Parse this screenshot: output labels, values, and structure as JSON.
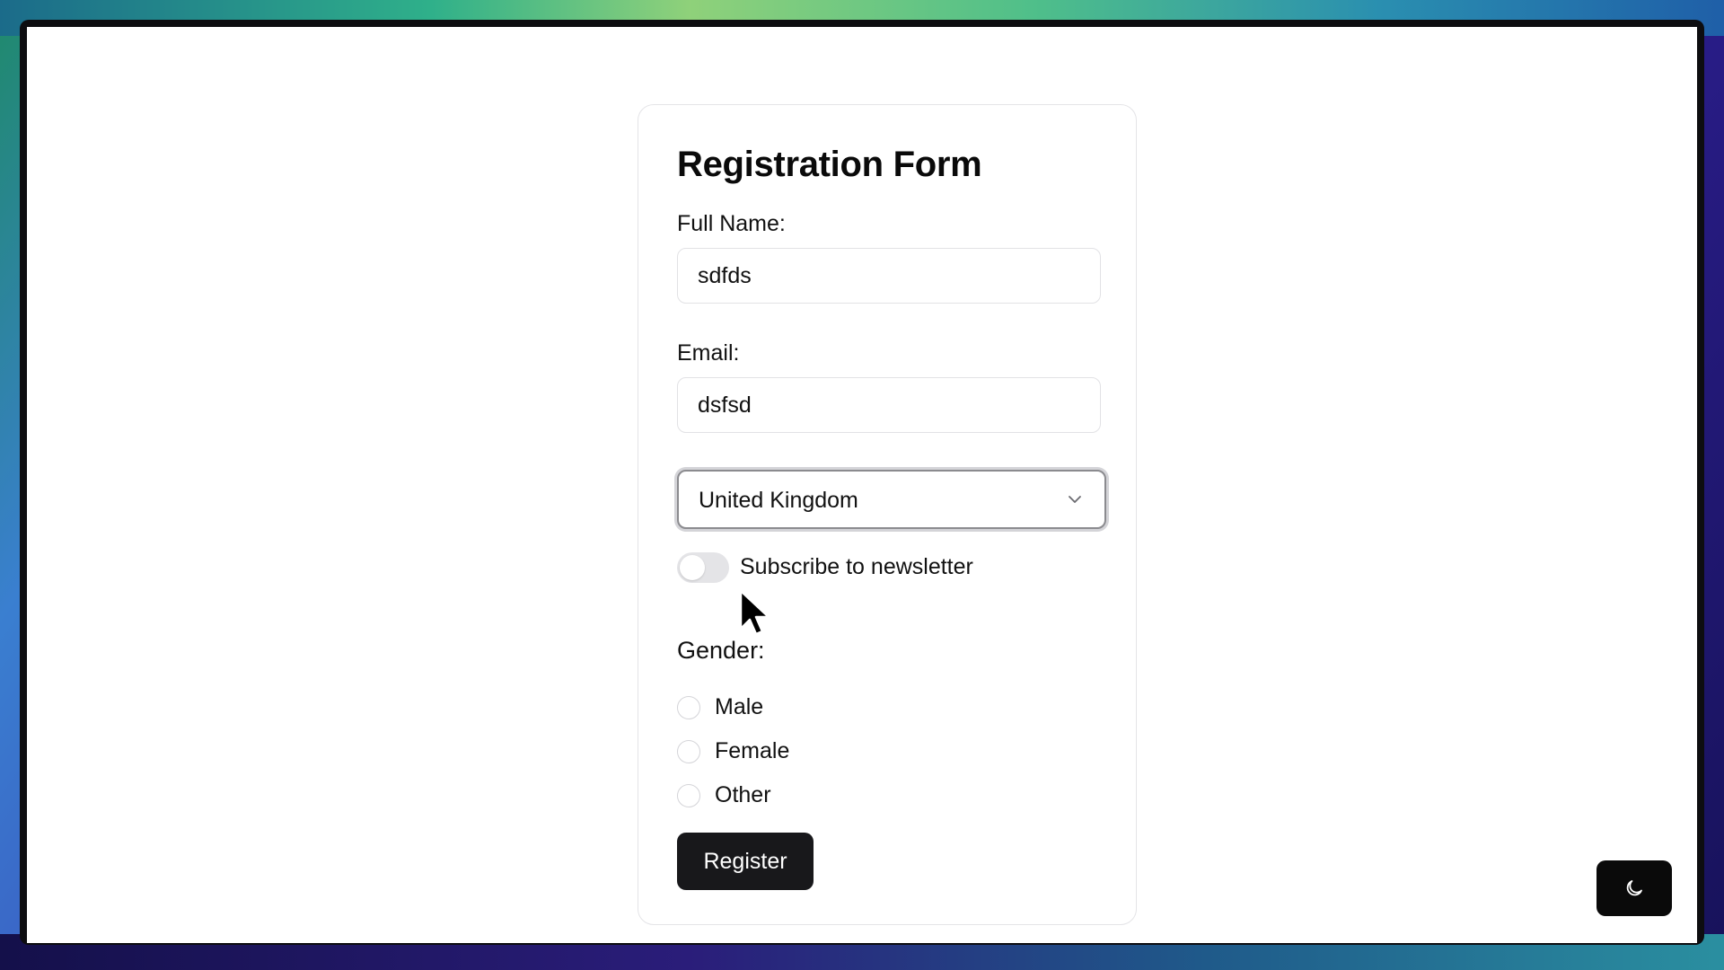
{
  "form": {
    "title": "Registration Form",
    "full_name_label": "Full Name:",
    "full_name_value": "sdfds",
    "email_label": "Email:",
    "email_value": "dsfsd",
    "country_value": "United Kingdom",
    "newsletter_label": "Subscribe to newsletter",
    "newsletter_on": false,
    "gender_label": "Gender:",
    "gender_options": [
      "Male",
      "Female",
      "Other"
    ],
    "gender_selected": null,
    "register_label": "Register"
  },
  "theme_toggle": {
    "icon": "moon-icon"
  },
  "colors": {
    "primary_button": "#18181b",
    "text": "#111111",
    "border": "#e4e4e7"
  }
}
